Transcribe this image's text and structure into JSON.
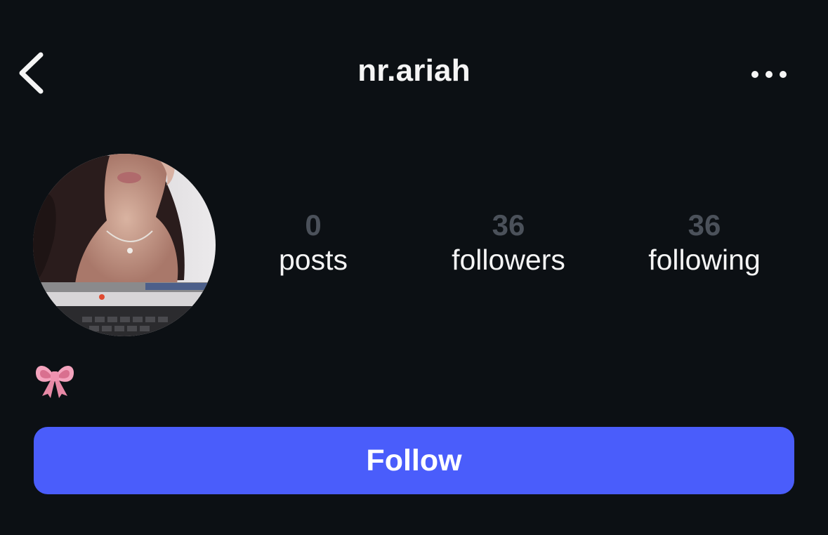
{
  "header": {
    "username": "nr.ariah",
    "back_icon": "chevron-left-icon",
    "more_icon": "more-horizontal-icon"
  },
  "profile": {
    "avatar": "profile-photo",
    "bio_emoji": "ribbon-emoji"
  },
  "stats": {
    "posts": {
      "count": "0",
      "label": "posts"
    },
    "followers": {
      "count": "36",
      "label": "followers"
    },
    "following": {
      "count": "36",
      "label": "following"
    }
  },
  "actions": {
    "follow_label": "Follow"
  },
  "colors": {
    "background": "#0c1014",
    "text": "#f5f5f5",
    "muted_count": "#4b515a",
    "accent_button": "#4a5dfb"
  }
}
